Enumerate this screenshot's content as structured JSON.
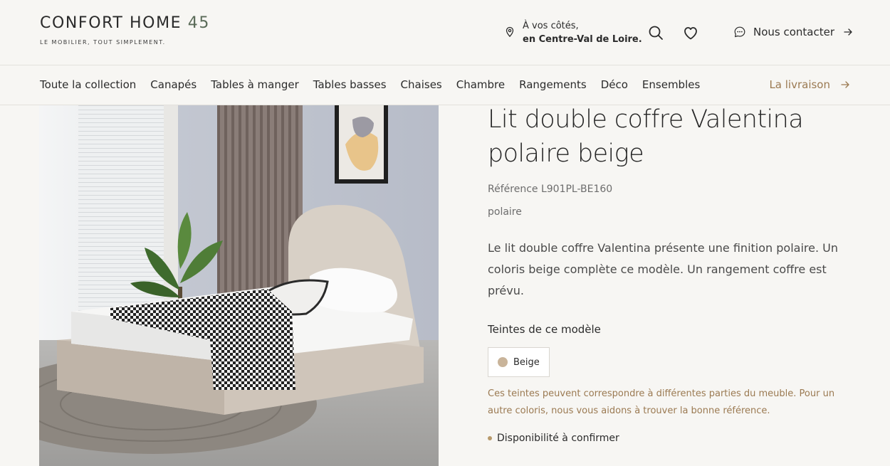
{
  "header": {
    "logo_main": "CONFORT HOME",
    "logo_num": "45",
    "tagline": "LE MOBILIER, TOUT SIMPLEMENT.",
    "location_line1": "À vos côtés,",
    "location_line2": "en Centre-Val de Loire.",
    "contact_label": "Nous contacter"
  },
  "nav": {
    "items": [
      "Toute la collection",
      "Canapés",
      "Tables à manger",
      "Tables basses",
      "Chaises",
      "Chambre",
      "Rangements",
      "Déco",
      "Ensembles"
    ],
    "delivery_label": "La livraison"
  },
  "product": {
    "title": "Lit double coffre Valentina polaire beige",
    "reference": "Référence L901PL-BE160",
    "finish": "polaire",
    "description": "Le lit double coffre Valentina présente une finition polaire. Un coloris beige complète ce modèle. Un rangement coffre est prévu.",
    "variants_title": "Teintes de ce modèle",
    "variant_label": "Beige",
    "variant_color": "#c9b49a",
    "note": "Ces teintes peuvent correspondre à différentes parties du meuble. Pour un autre coloris, nous vous aidons à trouver la bonne référence.",
    "availability": "Disponibilité à confirmer"
  },
  "colors": {
    "accent": "#9b7a52",
    "logo_number": "#5a6b58",
    "background": "#f7f6f3"
  }
}
